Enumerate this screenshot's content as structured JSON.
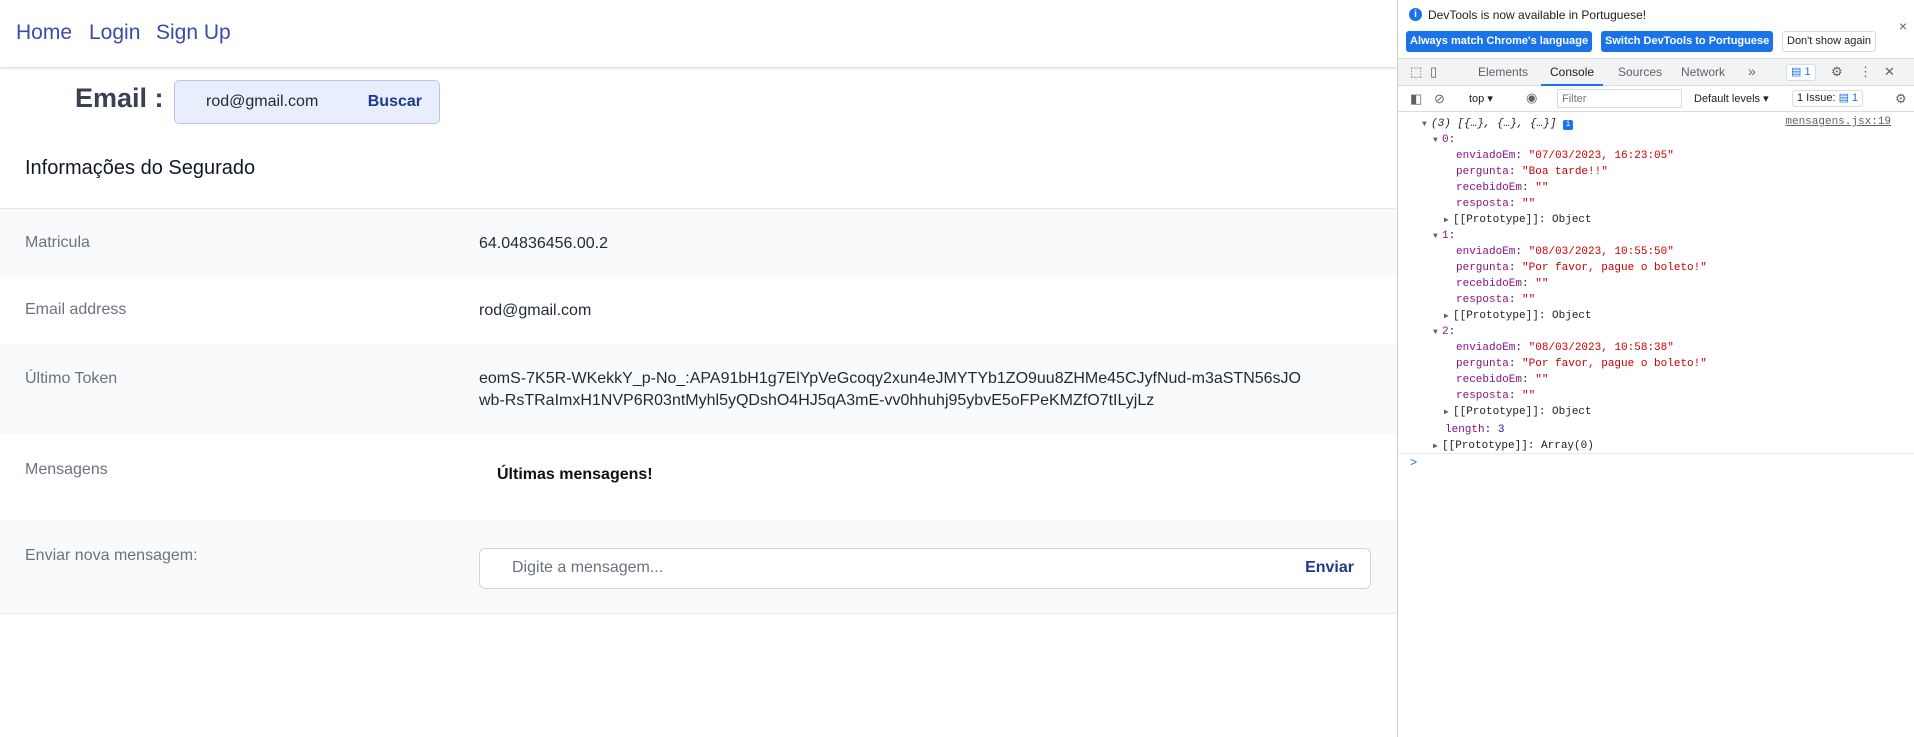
{
  "nav": {
    "links": [
      "Home",
      "Login",
      "Sign Up"
    ]
  },
  "search": {
    "label": "Email :",
    "value": "rod@gmail.com",
    "button": "Buscar"
  },
  "section": {
    "title": "Informações do Segurado"
  },
  "info": {
    "rows": [
      {
        "label": "Matricula",
        "value": "64.04836456.00.2"
      },
      {
        "label": "Email address",
        "value": "rod@gmail.com"
      },
      {
        "label": "Último Token",
        "value": "eomS-7K5R-WKekkY_p-No_:APA91bH1g7ElYpVeGcoqy2xun4eJMYTYb1ZO9uu8ZHMe45CJyfNud-m3aSTN56sJOwb-RsTRaImxH1NVP6R03ntMyhl5yQDshO4HJ5qA3mE-vv0hhuhj95ybvE5oFPeKMZfO7tILyjLz"
      },
      {
        "label": "Mensagens",
        "value": "Últimas mensagens!"
      },
      {
        "label": "Enviar nova mensagem:",
        "placeholder": "Digite a mensagem...",
        "button": "Enviar"
      }
    ]
  },
  "devtools": {
    "infobar": {
      "text": "DevTools is now available in Portuguese!",
      "btn_match": "Always match Chrome's language",
      "btn_switch": "Switch DevTools to Portuguese",
      "btn_dismiss": "Don't show again",
      "close": "×"
    },
    "tabs": [
      "Elements",
      "Console",
      "Sources",
      "Network"
    ],
    "active_tab": "Console",
    "more_tabs": "»",
    "messages_count": "1",
    "filterbar": {
      "context": "top",
      "filter_placeholder": "Filter",
      "levels": "Default levels",
      "issues_label": "1 Issue:",
      "issues_count": "1"
    },
    "console": {
      "source": "mensagens.jsx:19",
      "summary": "(3) [{…}, {…}, {…}]",
      "items": [
        {
          "index": "0",
          "enviadoEm": "\"07/03/2023, 16:23:05\"",
          "pergunta": "\"Boa tarde!!\"",
          "recebidoEm": "\"\"",
          "resposta": "\"\"",
          "proto": "[[Prototype]]: Object"
        },
        {
          "index": "1",
          "enviadoEm": "\"08/03/2023, 10:55:50\"",
          "pergunta": "\"Por favor, pague o boleto!\"",
          "recebidoEm": "\"\"",
          "resposta": "\"\"",
          "proto": "[[Prototype]]: Object"
        },
        {
          "index": "2",
          "enviadoEm": "\"08/03/2023, 10:58:38\"",
          "pergunta": "\"Por favor, pague o boleto!\"",
          "recebidoEm": "\"\"",
          "resposta": "\"\"",
          "proto": "[[Prototype]]: Object"
        }
      ],
      "length_key": "length",
      "length_value": "3",
      "array_proto": "[[Prototype]]: Array(0)",
      "prompt": ">"
    },
    "colors": {
      "accent": "#1a73e8",
      "key": "#881280",
      "string": "#c80000"
    }
  }
}
